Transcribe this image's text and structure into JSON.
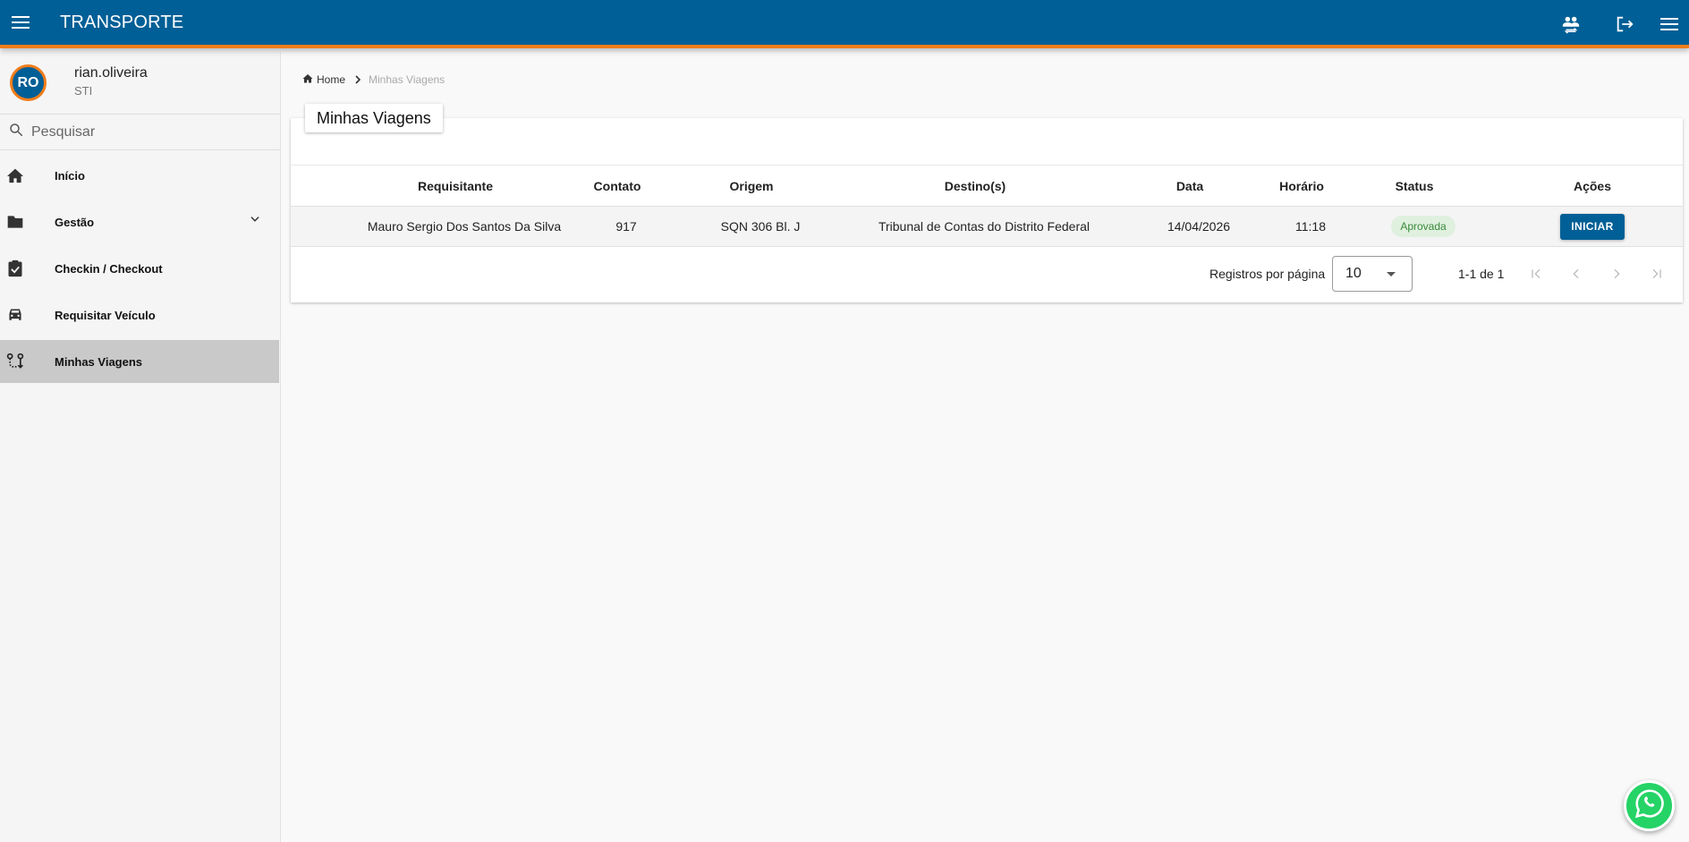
{
  "header": {
    "title": "TRANSPORTE"
  },
  "user": {
    "initials": "RO",
    "name": "rian.oliveira",
    "department": "STI"
  },
  "sidebar": {
    "search_placeholder": "Pesquisar",
    "items": [
      {
        "label": "Início",
        "icon": "home-icon"
      },
      {
        "label": "Gestão",
        "icon": "folder-icon"
      },
      {
        "label": "Checkin / Checkout",
        "icon": "clipboard-check-icon"
      },
      {
        "label": "Requisitar Veículo",
        "icon": "car-icon"
      },
      {
        "label": "Minhas Viagens",
        "icon": "route-icon"
      }
    ],
    "active_index": 4
  },
  "breadcrumb": {
    "home": "Home",
    "current": "Minhas Viagens"
  },
  "page": {
    "title": "Minhas Viagens"
  },
  "table": {
    "columns": [
      "Requisitante",
      "Contato",
      "Origem",
      "Destino(s)",
      "Data",
      "Horário",
      "Status",
      "Ações"
    ],
    "rows": [
      {
        "requisitante": "Mauro Sergio Dos Santos Da Silva",
        "contato": "917",
        "origem": "SQN 306 Bl. J",
        "destino": "Tribunal de Contas do Distrito Federal",
        "data": "14/04/2026",
        "horario": "11:18",
        "status": "Aprovada",
        "acao": "INICIAR"
      }
    ]
  },
  "pagination": {
    "rows_per_page_label": "Registros por página",
    "rows_per_page": "10",
    "range": "1-1 de 1"
  },
  "colors": {
    "primary": "#005f96",
    "accent": "#f07d1a",
    "status_approved": "#3a8a3a",
    "whatsapp": "#25d366"
  }
}
